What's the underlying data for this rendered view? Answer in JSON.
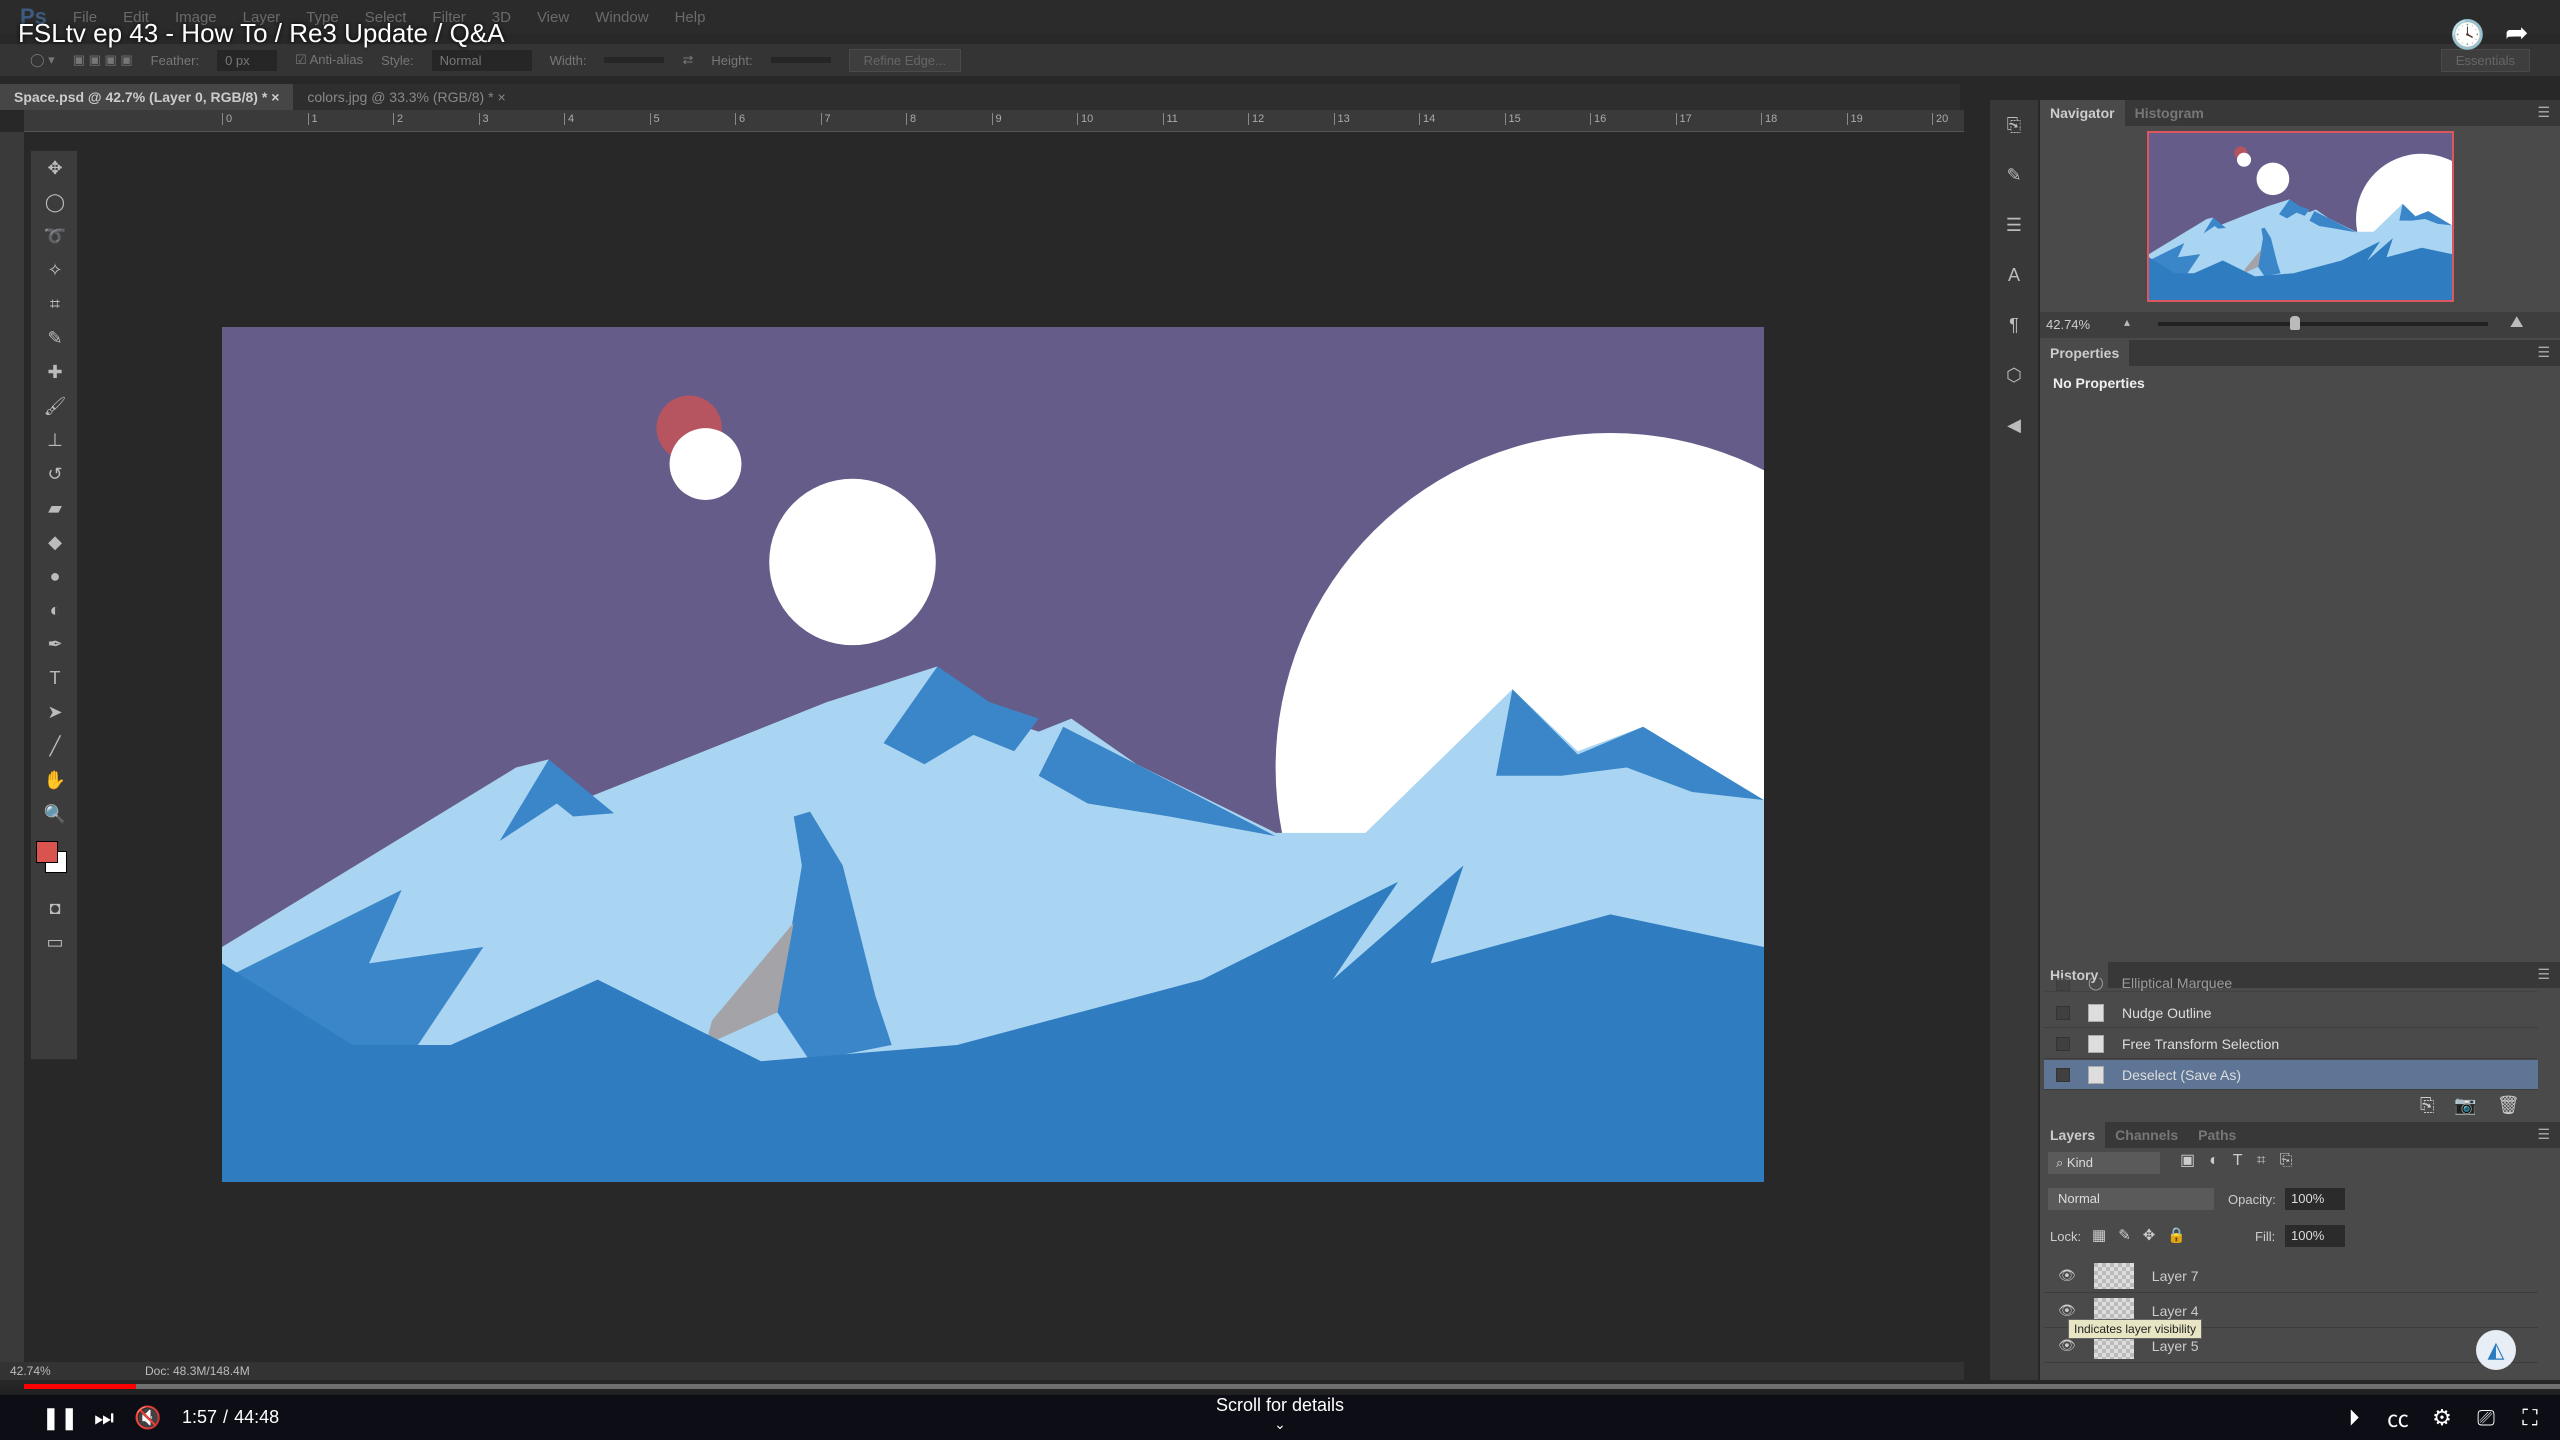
{
  "video": {
    "title": "FSLtv ep 43 - How To / Re3 Update / Q&A",
    "time_current": "1:57",
    "time_total": "44:48",
    "progress_percent": 4.4,
    "scroll_hint": "Scroll for details"
  },
  "menu": [
    "File",
    "Edit",
    "Image",
    "Layer",
    "Type",
    "Select",
    "Filter",
    "3D",
    "View",
    "Window",
    "Help"
  ],
  "app_logo": "Ps",
  "options": {
    "feather_label": "Feather:",
    "feather_value": "0 px",
    "antialias_label": "Anti-alias",
    "antialias_checked": true,
    "style_label": "Style:",
    "style_value": "Normal",
    "width_label": "Width:",
    "height_label": "Height:",
    "refine_edge": "Refine Edge...",
    "workspace": "Essentials"
  },
  "doc_tabs": [
    {
      "label": "Space.psd @ 42.7% (Layer 0, RGB/8) *",
      "active": true
    },
    {
      "label": "colors.jpg @ 33.3% (RGB/8) *",
      "active": false
    }
  ],
  "ruler_ticks": [
    "0",
    "1",
    "2",
    "3",
    "4",
    "5",
    "6",
    "7",
    "8",
    "9",
    "10",
    "11",
    "12",
    "13",
    "14",
    "15",
    "16",
    "17",
    "18",
    "19",
    "20"
  ],
  "status": {
    "zoom": "42.74%",
    "doc": "Doc: 48.3M/148.4M"
  },
  "colors": {
    "foreground": "#d9534f",
    "background": "#ffffff",
    "sky": "#655c8a",
    "snow": "#a9d5f3",
    "mountain": "#3a86c8",
    "ground": "#2f7cc0"
  },
  "navigator": {
    "tabs": [
      "Navigator",
      "Histogram"
    ],
    "zoom": "42.74%",
    "zoom_slider_fraction": 0.4
  },
  "properties": {
    "tab": "Properties",
    "content": "No Properties"
  },
  "history": {
    "tab": "History",
    "items": [
      {
        "label": "Elliptical Marquee",
        "selected": false
      },
      {
        "label": "Nudge Outline",
        "selected": false
      },
      {
        "label": "Free Transform Selection",
        "selected": false
      },
      {
        "label": "Deselect (Save As)",
        "selected": true
      }
    ]
  },
  "layers": {
    "tabs": [
      "Layers",
      "Channels",
      "Paths"
    ],
    "filter": "Kind",
    "blend_mode": "Normal",
    "opacity_label": "Opacity:",
    "opacity": "100%",
    "lock_label": "Lock:",
    "fill_label": "Fill:",
    "fill": "100%",
    "items": [
      "Layer 7",
      "Layer 4",
      "Layer 5"
    ],
    "tooltip": "Indicates layer visibility"
  }
}
